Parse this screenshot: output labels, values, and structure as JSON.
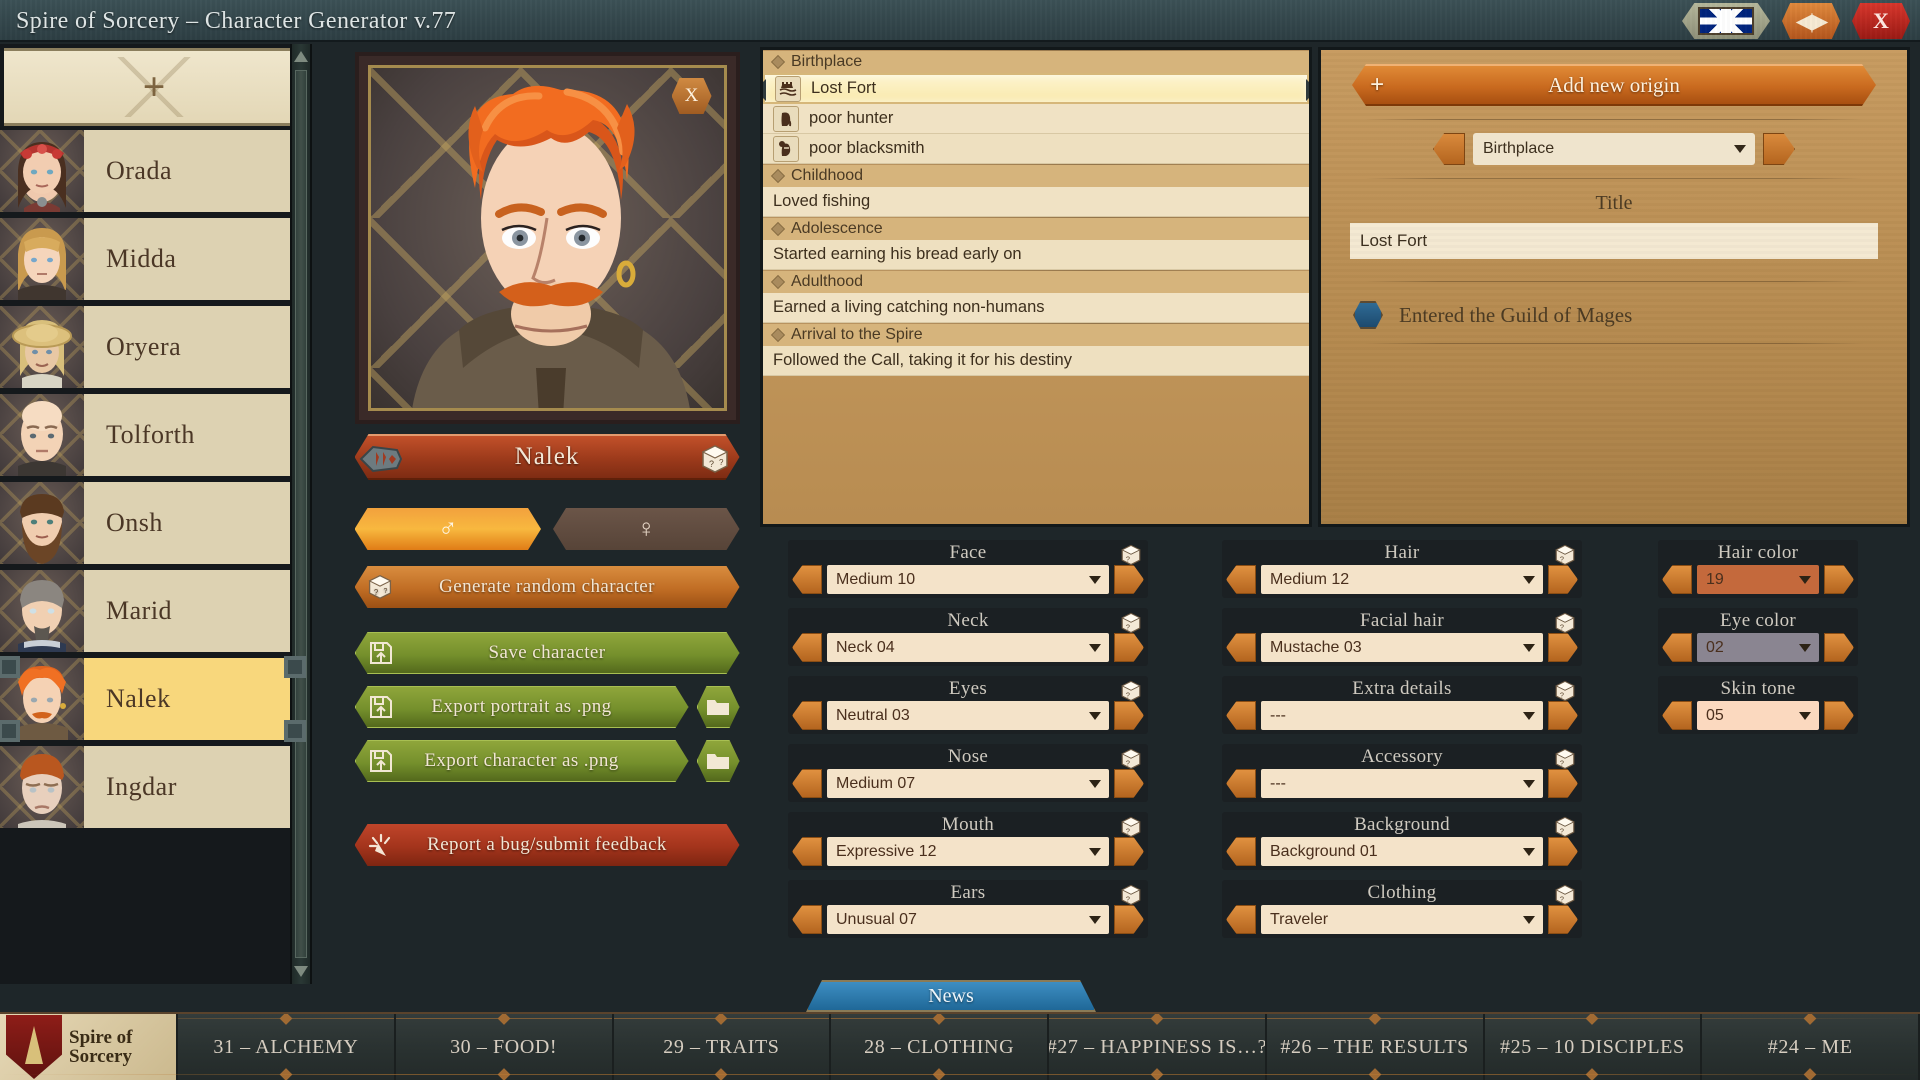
{
  "window": {
    "title": "Spire of Sorcery – Character Generator v.77",
    "buttons": [
      {
        "name": "language-button",
        "icon": "uk-flag-icon",
        "label": ""
      },
      {
        "name": "resize-button",
        "icon": "resize-icon",
        "label": "◀|▶"
      },
      {
        "name": "close-button",
        "icon": "close-icon",
        "label": "X"
      }
    ]
  },
  "character_list": {
    "add_label": "+",
    "characters": [
      {
        "name": "Orada",
        "selected": false
      },
      {
        "name": "Midda",
        "selected": false
      },
      {
        "name": "Oryera",
        "selected": false
      },
      {
        "name": "Tolforth",
        "selected": false
      },
      {
        "name": "Onsh",
        "selected": false
      },
      {
        "name": "Marid",
        "selected": false
      },
      {
        "name": "Nalek",
        "selected": true
      },
      {
        "name": "Ingdar",
        "selected": false
      }
    ]
  },
  "portrait": {
    "close_label": "X",
    "character_name": "Nalek",
    "randomize_icon": "dice-icon",
    "ornament_icon": "ornament-icon"
  },
  "gender": {
    "male_symbol": "♂",
    "female_symbol": "♀",
    "selected": "male"
  },
  "actions": {
    "generate_random": "Generate random character",
    "save_character": "Save character",
    "export_portrait": "Export portrait as .png",
    "export_character": "Export character as .png",
    "report_bug": "Report a bug/submit feedback"
  },
  "biography": {
    "sections": [
      {
        "heading": "Birthplace",
        "entries": [
          {
            "text": "Lost Fort",
            "icon": "castle-icon",
            "selected": true
          },
          {
            "text": "poor hunter",
            "icon": "hunter-icon",
            "selected": false
          },
          {
            "text": "poor blacksmith",
            "icon": "blacksmith-icon",
            "selected": false
          }
        ]
      },
      {
        "heading": "Childhood",
        "entries": [
          {
            "text": "Loved fishing",
            "icon": "",
            "selected": false
          }
        ]
      },
      {
        "heading": "Adolescence",
        "entries": [
          {
            "text": "Started earning his bread early on",
            "icon": "",
            "selected": false
          }
        ]
      },
      {
        "heading": "Adulthood",
        "entries": [
          {
            "text": "Earned a living catching non-humans",
            "icon": "",
            "selected": false
          }
        ]
      },
      {
        "heading": "Arrival to the Spire",
        "entries": [
          {
            "text": "Followed the Call, taking it for his destiny",
            "icon": "",
            "selected": false
          }
        ]
      }
    ]
  },
  "origin_editor": {
    "add_new_origin": "Add new origin",
    "plus_label": "+",
    "type_value": "Birthplace",
    "title_label": "Title",
    "title_value": "Lost Fort",
    "flags": [
      {
        "label": "Entered the Guild of Mages",
        "icon": "hex-blue-icon",
        "checked": true
      }
    ]
  },
  "appearance": {
    "column1": [
      {
        "label": "Face",
        "value": "Medium 10"
      },
      {
        "label": "Neck",
        "value": "Neck 04"
      },
      {
        "label": "Eyes",
        "value": "Neutral 03"
      },
      {
        "label": "Nose",
        "value": "Medium 07"
      },
      {
        "label": "Mouth",
        "value": "Expressive 12"
      },
      {
        "label": "Ears",
        "value": "Unusual 07"
      }
    ],
    "column2": [
      {
        "label": "Hair",
        "value": "Medium 12"
      },
      {
        "label": "Facial hair",
        "value": "Mustache 03"
      },
      {
        "label": "Extra details",
        "value": "---"
      },
      {
        "label": "Accessory",
        "value": "---"
      },
      {
        "label": "Background",
        "value": "Background 01"
      },
      {
        "label": "Clothing",
        "value": "Traveler"
      }
    ],
    "column3": [
      {
        "label": "Hair color",
        "value": "19",
        "swatch": "#c4693c"
      },
      {
        "label": "Eye color",
        "value": "02",
        "swatch": "#8a8591"
      },
      {
        "label": "Skin tone",
        "value": "05",
        "swatch": "#fbd9bf"
      }
    ]
  },
  "news": {
    "tab_label": "News",
    "logo_line1": "Spire of",
    "logo_line2": "Sorcery",
    "items": [
      "31 – ALCHEMY",
      "30 – FOOD!",
      "29 – TRAITS",
      "28 – CLOTHING",
      "#27 – HAPPINESS IS…?",
      "#26 – THE RESULTS",
      "#25 – 10 DISCIPLES",
      "#24 – ME"
    ]
  },
  "colors": {
    "accent_orange": "#c96a1f",
    "parchment": "#f0e2c4",
    "panel_brown": "#b58a4f",
    "dark_bg": "#1e2629",
    "selected_yellow": "#f8d77c"
  }
}
